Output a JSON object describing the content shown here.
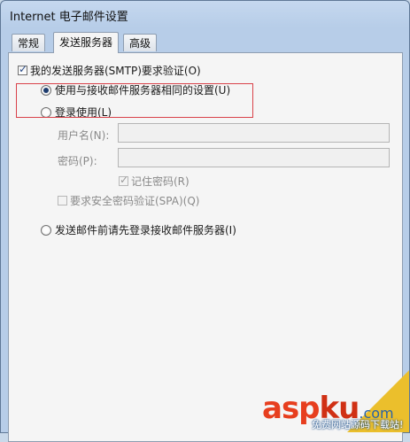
{
  "window": {
    "title": "Internet 电子邮件设置"
  },
  "tabs": [
    {
      "label": "常规"
    },
    {
      "label": "发送服务器"
    },
    {
      "label": "高级"
    }
  ],
  "outgoing": {
    "require_auth": {
      "label": "我的发送服务器(SMTP)要求验证(O)",
      "checked": true
    },
    "use_same_settings": {
      "label": "使用与接收邮件服务器相同的设置(U)",
      "selected": true
    },
    "log_on_using": {
      "label": "登录使用(L)",
      "selected": false
    },
    "username": {
      "label": "用户名(N):",
      "value": ""
    },
    "password": {
      "label": "密码(P):",
      "value": ""
    },
    "remember_password": {
      "label": "记住密码(R)",
      "checked": true
    },
    "require_spa": {
      "label": "要求安全密码验证(SPA)(Q)",
      "checked": false
    },
    "log_on_incoming_first": {
      "label": "发送邮件前请先登录接收邮件服务器(I)",
      "selected": false
    }
  },
  "watermark": {
    "brand_a": "asp",
    "brand_b": "ku",
    "brand_c": ".com",
    "subtitle": "免费网站源码下载站!"
  },
  "colors": {
    "highlight_border": "#d9424a",
    "watermark_red": "#e73e1e"
  }
}
